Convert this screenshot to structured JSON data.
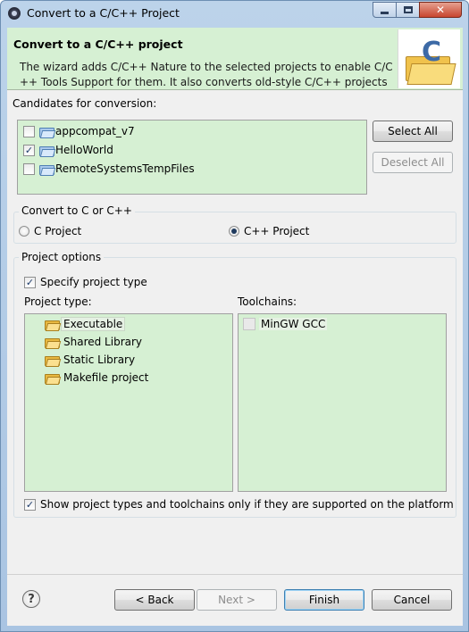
{
  "window": {
    "title": "Convert to a C/C++ Project",
    "minimize_icon": "minimize-icon",
    "maximize_icon": "maximize-icon",
    "close_glyph": "✕"
  },
  "banner": {
    "title": "Convert to a C/C++ project",
    "description": "The wizard adds C/C++ Nature to the selected projects to enable C/C\n++ Tools Support for them. It also converts old-style C/C++ projects"
  },
  "candidates": {
    "label": "Candidates for conversion:",
    "items": [
      {
        "label": "appcompat_v7",
        "checked": false
      },
      {
        "label": "HelloWorld",
        "checked": true
      },
      {
        "label": "RemoteSystemsTempFiles",
        "checked": false
      }
    ],
    "select_all": "Select All",
    "deselect_all": "Deselect All"
  },
  "convert_to": {
    "label": "Convert to C or C++",
    "options": [
      {
        "label": "C Project",
        "selected": false
      },
      {
        "label": "C++ Project",
        "selected": true
      }
    ]
  },
  "project_options": {
    "label": "Project options",
    "specify_type": {
      "label": "Specify project type",
      "checked": true
    },
    "project_type_label": "Project type:",
    "toolchains_label": "Toolchains:",
    "project_types": [
      {
        "label": "Executable",
        "selected": true
      },
      {
        "label": "Shared Library",
        "selected": false
      },
      {
        "label": "Static Library",
        "selected": false
      },
      {
        "label": "Makefile project",
        "selected": false
      }
    ],
    "toolchains": [
      "MinGW GCC"
    ],
    "show_supported_only": {
      "label": "Show project types and toolchains only if they are supported on the platform",
      "checked": true
    }
  },
  "footer": {
    "help": "?",
    "back": "< Back",
    "next": "Next >",
    "finish": "Finish",
    "cancel": "Cancel"
  },
  "check_glyph": "✓",
  "colors": {
    "panel_green": "#d6f0d3",
    "dialog_bg": "#f0f0f0",
    "titlebar": "#bcd3ea"
  }
}
